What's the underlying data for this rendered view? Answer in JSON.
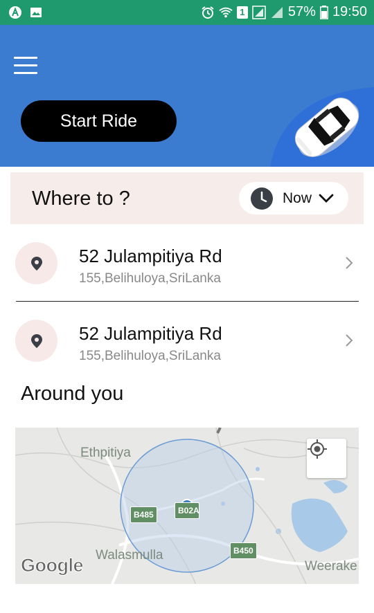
{
  "status_bar": {
    "battery": "57%",
    "time": "19:50",
    "sim_badge": "1",
    "icons": [
      "app-a-icon",
      "image-icon",
      "alarm-icon",
      "wifi-icon",
      "signal-icon",
      "battery-icon"
    ]
  },
  "header": {
    "menu_icon": "hamburger-icon",
    "start_ride_label": "Start Ride",
    "car_icon": "car-icon",
    "background_color": "#3b7bd0"
  },
  "where_to": {
    "label": "Where to ?",
    "time_option": "Now"
  },
  "saved_places": [
    {
      "title": "52 Julampitiya Rd",
      "subtitle": "155,Belihuloya,SriLanka"
    },
    {
      "title": "52 Julampitiya Rd",
      "subtitle": "155,Belihuloya,SriLanka"
    }
  ],
  "around": {
    "title": "Around you"
  },
  "map": {
    "labels": {
      "ethpitiya": "Ethpitiya",
      "walasmulla": "Walasmulla",
      "weerake": "Weerake"
    },
    "roads": {
      "b485": "B485",
      "b02": "B02A",
      "b450": "B450"
    },
    "logo": "Google",
    "locate_icon": "my-location-icon"
  },
  "colors": {
    "status_bar": "#1e9a6e",
    "accent_blue": "#3b7bd0",
    "where_to_bg": "#f6ecea"
  }
}
